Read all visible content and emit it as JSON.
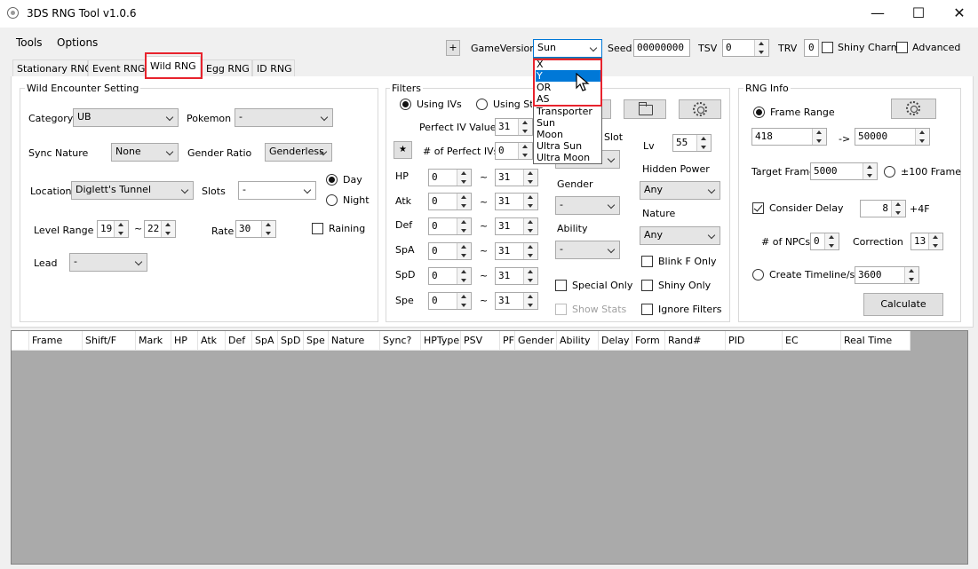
{
  "window": {
    "title": "3DS RNG Tool v1.0.6",
    "minimize": "—",
    "maximize": "☐",
    "close": "✕"
  },
  "menu": {
    "tools": "Tools",
    "options": "Options"
  },
  "tabs": [
    "Stationary RNG",
    "Event RNG",
    "Wild RNG",
    "Egg RNG",
    "ID RNG"
  ],
  "topbar": {
    "plus": "+",
    "game_version_label": "GameVersion",
    "game_version_value": "Sun",
    "seed_label": "Seed",
    "seed_value": "00000000",
    "tsv_label": "TSV",
    "tsv_value": "0",
    "trv_label": "TRV",
    "trv_value": "0",
    "shiny_charm": "Shiny Charm",
    "advanced": "Advanced"
  },
  "game_versions": [
    "X",
    "Y",
    "OR",
    "AS",
    "Transporter",
    "Sun",
    "Moon",
    "Ultra Sun",
    "Ultra Moon"
  ],
  "game_version_highlighted": "Y",
  "wild": {
    "legend": "Wild Encounter Setting",
    "category_label": "Category",
    "category_value": "UB",
    "pokemon_label": "Pokemon",
    "pokemon_value": "-",
    "sync_label": "Sync Nature",
    "sync_value": "None",
    "gender_ratio_label": "Gender Ratio",
    "gender_ratio_value": "Genderless",
    "day": "Day",
    "night": "Night",
    "location_label": "Location",
    "location_value": "Diglett's Tunnel",
    "slots_label": "Slots",
    "slots_value": "-",
    "level_label": "Level Range",
    "level_min": "19",
    "level_tilde": "~",
    "level_max": "22",
    "rate_label": "Rate",
    "rate_value": "30",
    "raining": "Raining",
    "lead_label": "Lead",
    "lead_value": "-"
  },
  "filters": {
    "legend": "Filters",
    "using_ivs": "Using IVs",
    "using_stats": "Using Stats",
    "perfect_iv_label": "Perfect IV Value",
    "perfect_iv_value": "31",
    "star": "★",
    "num_perfect_label": "# of Perfect IVs",
    "num_perfect_value": "0",
    "slot_label": "Slot",
    "stats": [
      {
        "name": "HP",
        "min": "0",
        "max": "31"
      },
      {
        "name": "Atk",
        "min": "0",
        "max": "31"
      },
      {
        "name": "Def",
        "min": "0",
        "max": "31"
      },
      {
        "name": "SpA",
        "min": "0",
        "max": "31"
      },
      {
        "name": "SpD",
        "min": "0",
        "max": "31"
      },
      {
        "name": "Spe",
        "min": "0",
        "max": "31"
      }
    ],
    "tilde": "~",
    "lv_label": "Lv",
    "lv_value": "55",
    "hidden_power_label": "Hidden Power",
    "hidden_power_value": "Any",
    "gender_label": "Gender",
    "gender_value": "-",
    "nature_label": "Nature",
    "nature_value": "Any",
    "ability_label": "Ability",
    "ability_value": "-",
    "blink": "Blink F Only",
    "special_only": "Special Only",
    "shiny_only": "Shiny Only",
    "show_stats": "Show Stats",
    "ignore_filters": "Ignore Filters"
  },
  "rnginfo": {
    "legend": "RNG Info",
    "frame_range": "Frame Range",
    "frame_min": "418",
    "arrow": "->",
    "frame_max": "50000",
    "target_label": "Target Frame",
    "target_value": "5000",
    "pm100": "±100 Frame",
    "consider_delay": "Consider Delay",
    "delay_value": "8",
    "plus4f": "+4F",
    "npcs_label": "# of NPCs",
    "npcs_value": "0",
    "correction_label": "Correction",
    "correction_value": "13",
    "timeline_label": "Create Timeline/s",
    "timeline_value": "3600",
    "calculate": "Calculate"
  },
  "columns": [
    "Frame",
    "Shift/F",
    "Mark",
    "HP",
    "Atk",
    "Def",
    "SpA",
    "SpD",
    "Spe",
    "Nature",
    "Sync?",
    "HPType",
    "PSV",
    "PF",
    "Gender",
    "Ability",
    "Delay",
    "Form",
    "Rand#",
    "PID",
    "EC",
    "Real Time"
  ]
}
